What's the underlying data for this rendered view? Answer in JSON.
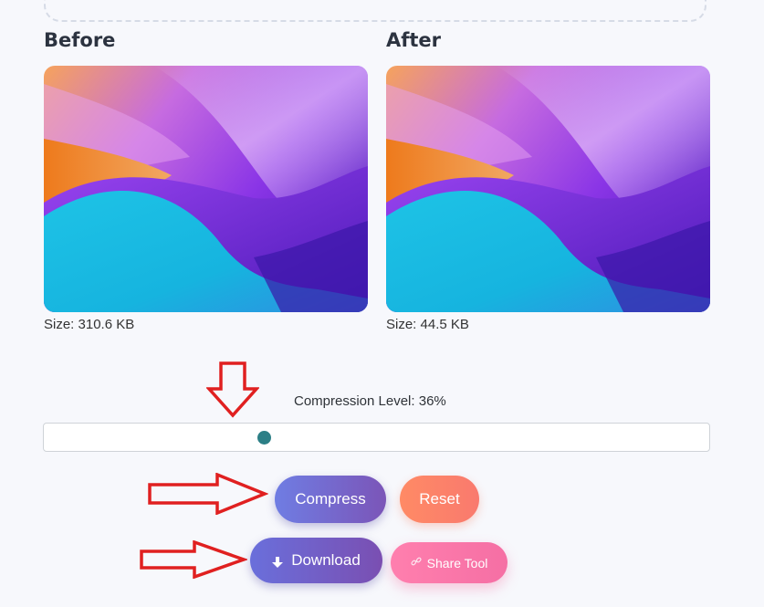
{
  "before": {
    "title": "Before",
    "size_text": "Size: 310.6 KB"
  },
  "after": {
    "title": "After",
    "size_text": "Size: 44.5 KB"
  },
  "compression": {
    "label": "Compression Level: 36%",
    "level": 0.33
  },
  "buttons": {
    "compress": "Compress",
    "reset": "Reset",
    "download": "Download",
    "share": "Share Tool"
  },
  "icons": {
    "download": "download-arrow-icon",
    "share": "link-icon",
    "annotation": "red-outline-arrow"
  },
  "colors": {
    "annotation_arrow": "#e02020",
    "slider_thumb": "#2c7f86"
  }
}
